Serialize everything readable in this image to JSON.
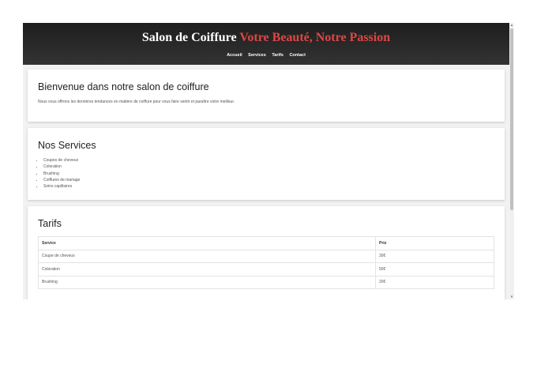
{
  "header": {
    "title_main": "Salon de Coiffure",
    "title_accent": "Votre Beauté, Notre Passion",
    "nav": [
      "Accueil",
      "Services",
      "Tarifs",
      "Contact"
    ]
  },
  "welcome": {
    "heading": "Bienvenue dans notre salon de coiffure",
    "text": "Nous vous offrons les dernières tendances en matière de coiffure pour vous faire sentir et paraître votre meilleur."
  },
  "services": {
    "heading": "Nos Services",
    "items": [
      "Coupes de cheveux",
      "Coloration",
      "Brushing",
      "Coiffures de mariage",
      "Soins capillaires"
    ]
  },
  "tarifs": {
    "heading": "Tarifs",
    "columns": [
      "Service",
      "Prix"
    ],
    "rows": [
      [
        "Coupe de cheveux",
        "30€"
      ],
      [
        "Coloration",
        "50€"
      ],
      [
        "Brushing",
        "20€"
      ]
    ]
  },
  "colors": {
    "accent": "#e04545",
    "header_bg": "#2b2b2b"
  }
}
